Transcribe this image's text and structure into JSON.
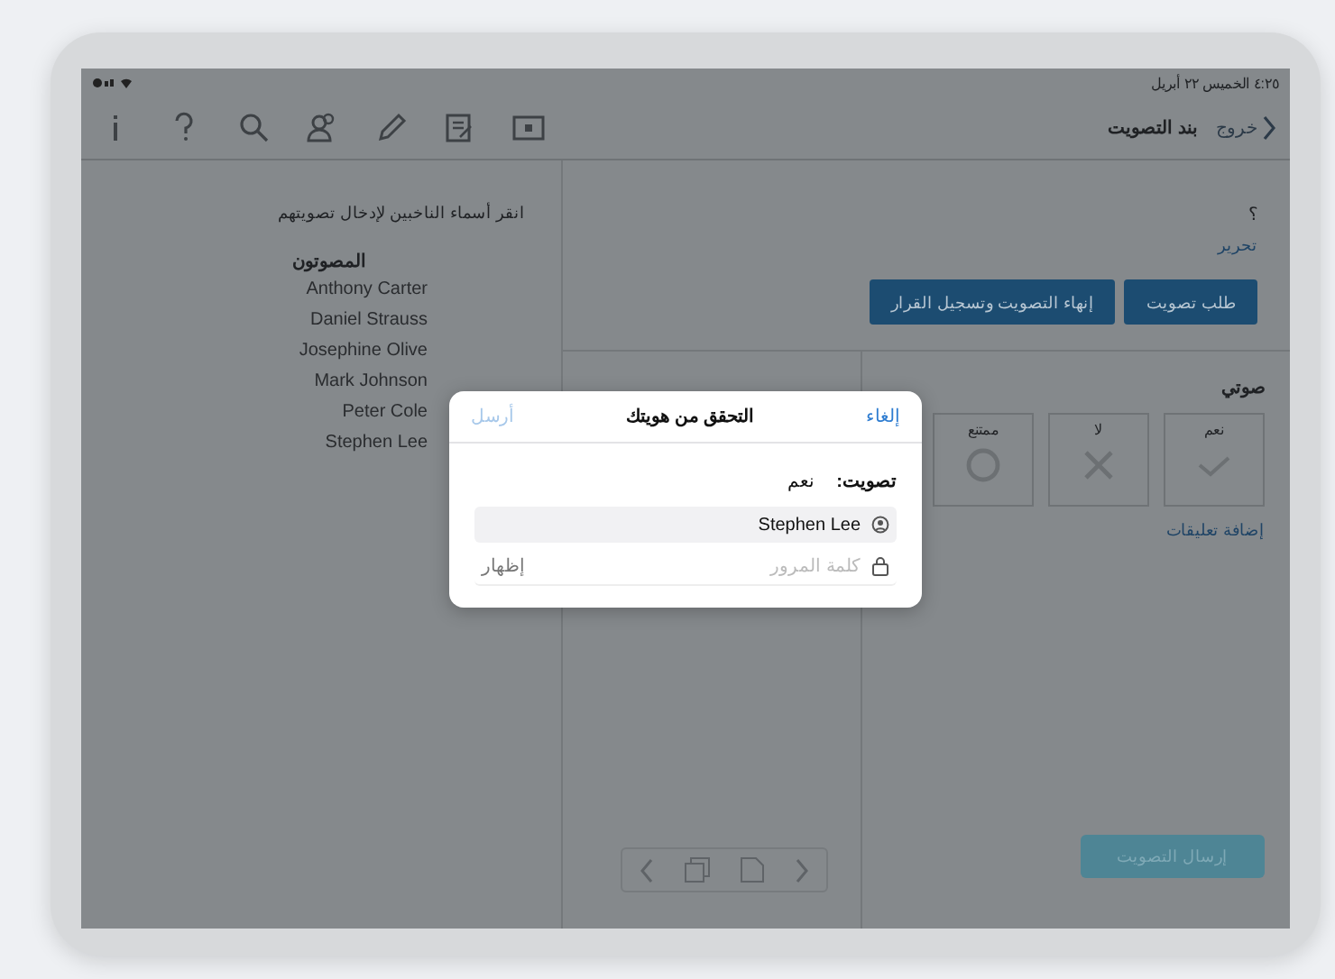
{
  "status_bar": {
    "clock": "٤:٢٥ الخميس ٢٢ أبريل"
  },
  "nav": {
    "back": {
      "label": "خروج",
      "disabled": true
    },
    "title": "بند التصويت"
  },
  "voters_pane": {
    "instruction": "انقر أسماء الناخبين لإدخال تصويتهم",
    "heading": "المصوتون",
    "voters": [
      "Anthony Carter",
      "Daniel Strauss",
      "Josephine Olive",
      "Mark Johnson",
      "Peter Cole",
      "Stephen Lee"
    ]
  },
  "item": {
    "title": "؟",
    "edit_link": "تحرير",
    "buttons": [
      "طلب تصويت",
      "إنهاء التصويت وتسجيل القرار"
    ]
  },
  "my_vote": {
    "heading": "صوتي",
    "options": [
      {
        "label": "نعم",
        "kind": "yes",
        "selected": false
      },
      {
        "label": "لا",
        "kind": "no",
        "selected": false
      },
      {
        "label": "ممتنع",
        "kind": "abstain",
        "selected": false
      }
    ],
    "comments_link": "إضافة تعليقات"
  },
  "submit_button": {
    "label": "إرسال التصويت",
    "disabled": true
  },
  "dialog": {
    "cancel": "إلغاء",
    "title": "التحقق من هويتك",
    "send": {
      "label": "أرسل",
      "disabled": true
    },
    "vote_label": "تصويت:",
    "vote_value": "نعم",
    "username": "Stephen Lee",
    "password_placeholder": "كلمة المرور",
    "show_button": "إظهار"
  }
}
